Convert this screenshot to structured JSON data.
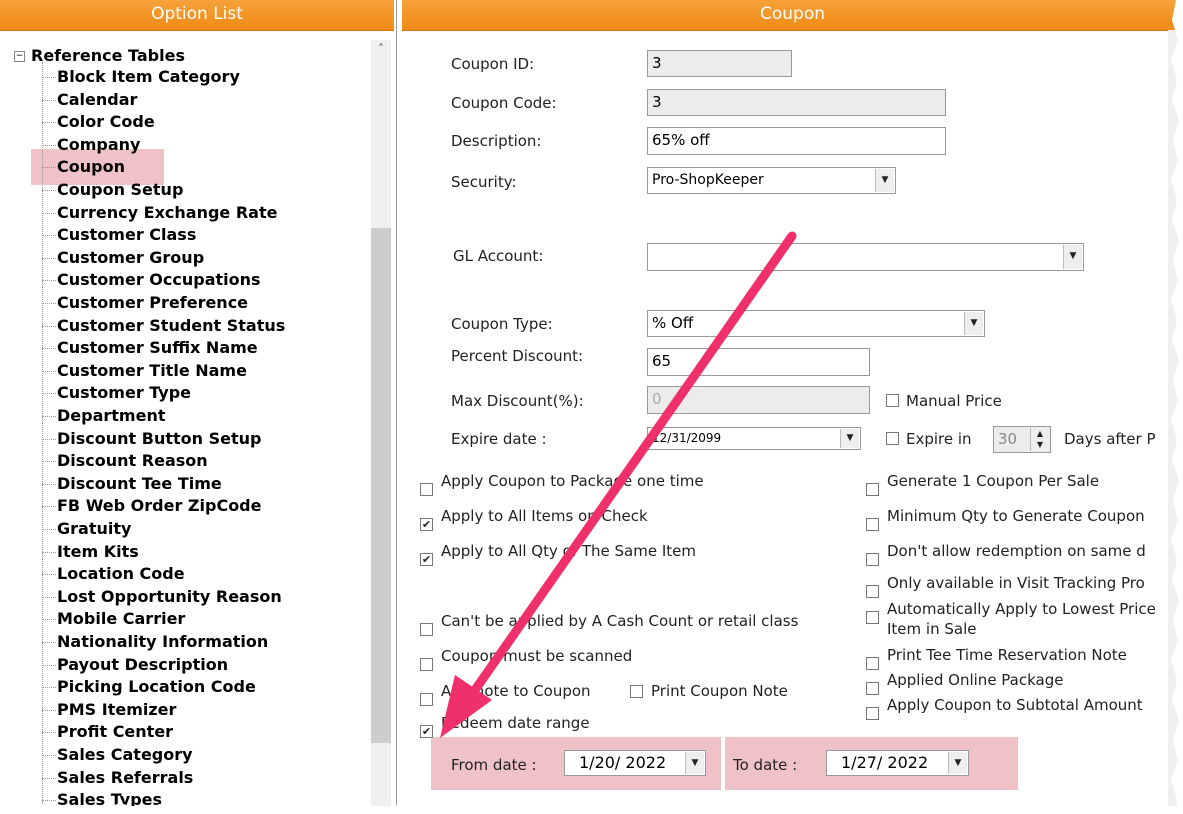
{
  "left_panel": {
    "title": "Option List",
    "tree_root": "Reference Tables",
    "items": [
      "Block Item Category",
      "Calendar",
      "Color Code",
      "Company",
      "Coupon",
      "Coupon Setup",
      "Currency Exchange Rate",
      "Customer Class",
      "Customer Group",
      "Customer Occupations",
      "Customer Preference",
      "Customer Student Status",
      "Customer Suffix Name",
      "Customer Title Name",
      "Customer Type",
      "Department",
      "Discount Button Setup",
      "Discount Reason",
      "Discount Tee Time",
      "FB Web Order ZipCode",
      "Gratuity",
      "Item Kits",
      "Location Code",
      "Lost Opportunity Reason",
      "Mobile Carrier",
      "Nationality Information",
      "Payout Description",
      "Picking Location Code",
      "PMS Itemizer",
      "Profit Center",
      "Sales Category",
      "Sales Referrals",
      "Sales Types"
    ],
    "selected_item": "Coupon",
    "highlight_color": "#dc7882"
  },
  "form": {
    "title": "Coupon",
    "coupon_id_label": "Coupon ID:",
    "coupon_id_value": "3",
    "coupon_code_label": "Coupon Code:",
    "coupon_code_value": "3",
    "description_label": "Description:",
    "description_value": "65% off",
    "security_label": "Security:",
    "security_value": "Pro-ShopKeeper",
    "gl_account_label": "GL Account:",
    "gl_account_value": "",
    "coupon_type_label": "Coupon Type:",
    "coupon_type_value": "% Off",
    "percent_discount_label": "Percent Discount:",
    "percent_discount_value": "65",
    "max_discount_label": "Max Discount(%):",
    "max_discount_value": "0",
    "manual_price_label": "Manual Price",
    "expire_date_label": "Expire date :",
    "expire_date_value": "12/31/2099",
    "expire_in_label": "Expire in",
    "expire_in_value": "30",
    "days_after_label": "Days after P",
    "left_checks": [
      {
        "label": "Apply Coupon to Package one time",
        "checked": false
      },
      {
        "label": "Apply to All Items on Check",
        "checked": true
      },
      {
        "label": "Apply to All Qty of The Same Item",
        "checked": true
      },
      {
        "label": "Can't be applied by A Cash Count or retail class",
        "checked": false
      },
      {
        "label": "Coupon must be scanned",
        "checked": false
      },
      {
        "label": "Add note to Coupon",
        "checked": false
      },
      {
        "label": "Redeem date range",
        "checked": true
      }
    ],
    "print_coupon_note_label": "Print Coupon Note",
    "right_checks": [
      {
        "label": "Generate 1 Coupon Per Sale",
        "checked": false
      },
      {
        "label": "Minimum Qty to Generate Coupon",
        "checked": false
      },
      {
        "label": "Don't allow redemption on same d",
        "checked": false
      },
      {
        "label": "Only available in Visit Tracking Pro",
        "checked": false
      },
      {
        "label": "Automatically Apply to Lowest Price",
        "label2": "Item in Sale",
        "checked": false
      },
      {
        "label": "Print Tee Time Reservation Note",
        "checked": false
      },
      {
        "label": "Applied Online Package",
        "checked": false
      },
      {
        "label": "Apply Coupon to Subtotal Amount",
        "checked": false
      }
    ],
    "from_date_label": "From date :",
    "from_date_value": "1/20/ 2022",
    "to_date_label": "To date :",
    "to_date_value": "1/27/ 2022"
  },
  "colors": {
    "header_orange": "#f08a14",
    "highlight": "#dc7882",
    "arrow": "#f0306a"
  }
}
